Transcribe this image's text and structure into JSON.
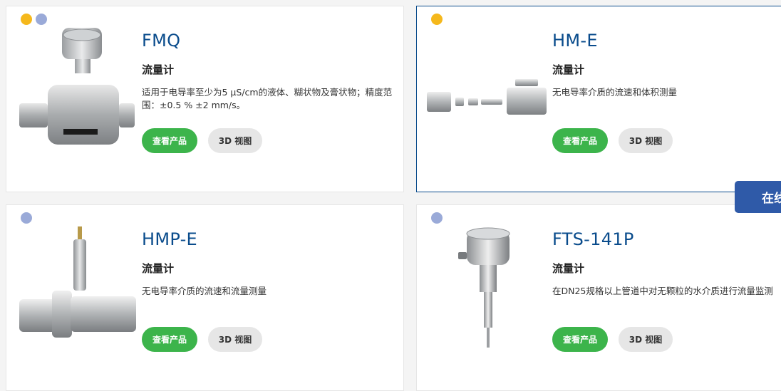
{
  "products": [
    {
      "title": "FMQ",
      "subtitle": "流量计",
      "description": "适用于电导率至少为5 µS/cm的液体、糊状物及膏状物；精度范围：±0.5 % ±2 mm/s。",
      "view_button": "查看产品",
      "model_button": "3D 视图",
      "dots": [
        "yellow",
        "blue"
      ]
    },
    {
      "title": "HM-E",
      "subtitle": "流量计",
      "description": "无电导率介质的流速和体积测量",
      "view_button": "查看产品",
      "model_button": "3D 视图",
      "dots": [
        "yellow"
      ]
    },
    {
      "title": "HMP-E",
      "subtitle": "流量计",
      "description": "无电导率介质的流速和流量测量",
      "view_button": "查看产品",
      "model_button": "3D 视图",
      "dots": [
        "blue"
      ]
    },
    {
      "title": "FTS-141P",
      "subtitle": "流量计",
      "description": "在DN25规格以上管道中对无颗粒的水介质进行流量监测",
      "view_button": "查看产品",
      "model_button": "3D 视图",
      "dots": [
        "blue"
      ]
    }
  ],
  "overlay": {
    "label": "在线"
  },
  "colors": {
    "title": "#0a4c8c",
    "primary_button": "#3cb44b",
    "secondary_button": "#e6e6e6",
    "dot_yellow": "#f5b81c",
    "dot_blue": "#9aaad8",
    "overlay": "#2f5aa8"
  }
}
